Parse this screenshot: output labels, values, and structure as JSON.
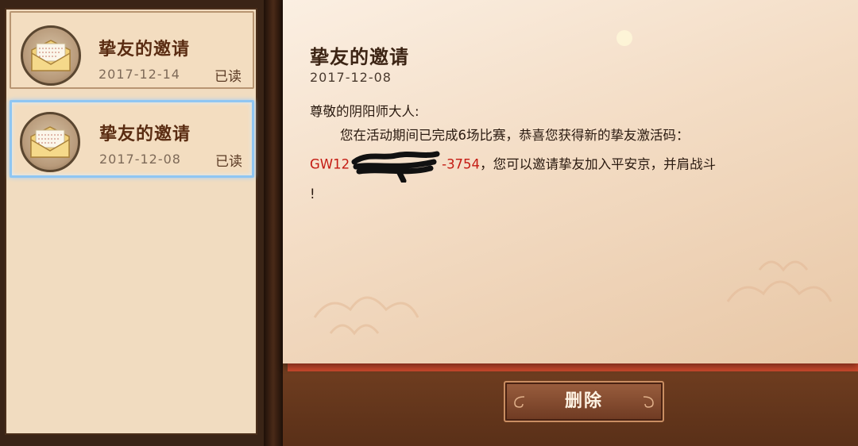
{
  "mail_list": {
    "items": [
      {
        "title": "挚友的邀请",
        "date": "2017-12-14",
        "status": "已读",
        "selected": false,
        "icon": "envelope-icon"
      },
      {
        "title": "挚友的邀请",
        "date": "2017-12-08",
        "status": "已读",
        "selected": true,
        "icon": "envelope-icon"
      }
    ]
  },
  "message": {
    "title": "挚友的邀请",
    "date": "2017-12-08",
    "greeting": "尊敬的阴阳师大人:",
    "line1": "您在活动期间已完成6场比赛，恭喜您获得新的挚友激活码：",
    "code_prefix": "GW12",
    "code_suffix": "-3754",
    "line2_tail": "，您可以邀请挚友加入平安京，并肩战斗",
    "line3": "!"
  },
  "actions": {
    "delete_label": "删除"
  },
  "colors": {
    "code_red": "#c41a12",
    "selected_border": "#8fc6f2",
    "title_brown": "#5a2c12"
  }
}
